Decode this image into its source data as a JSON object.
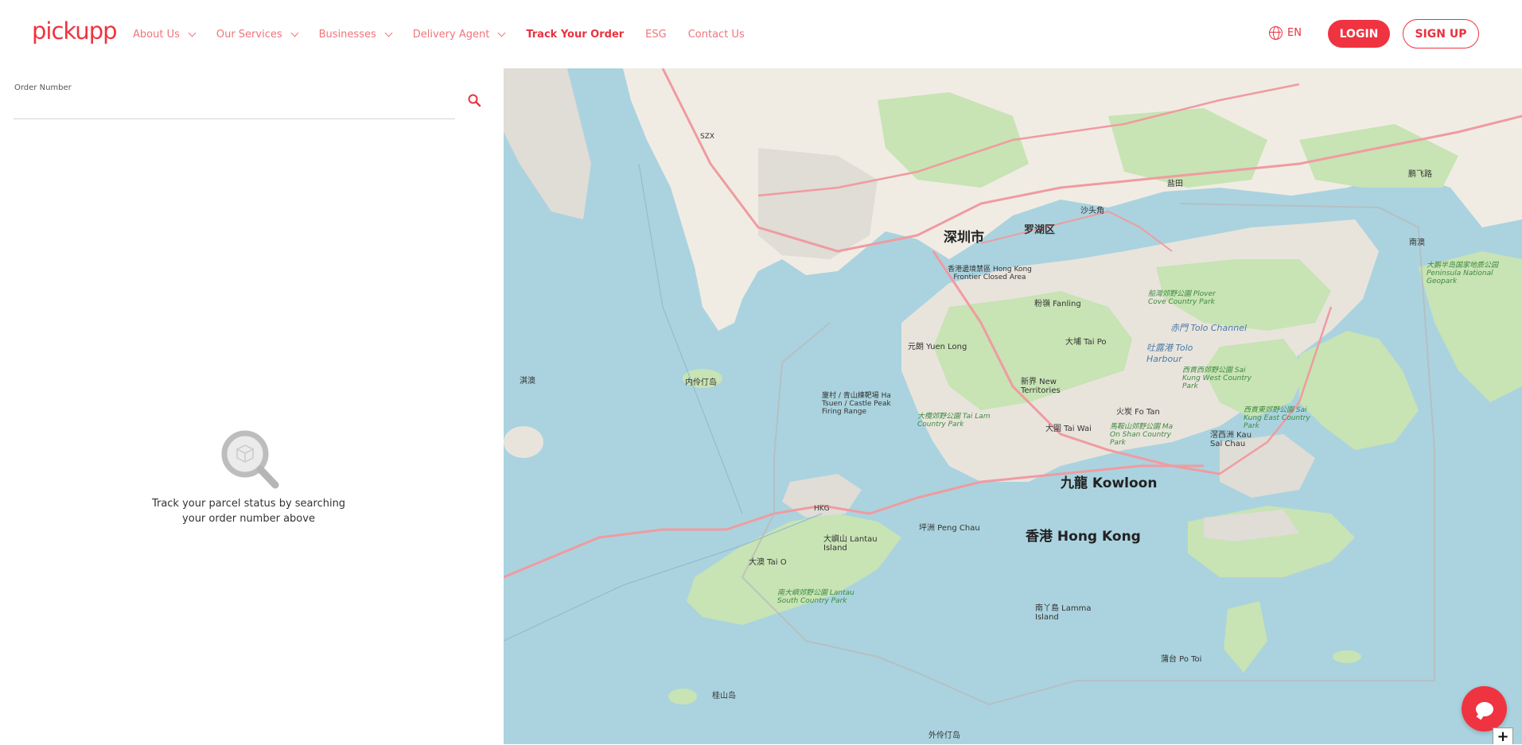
{
  "header": {
    "logo_text": "pickupp",
    "nav": [
      {
        "label": "About Us",
        "has_dropdown": true
      },
      {
        "label": "Our Services",
        "has_dropdown": true
      },
      {
        "label": "Businesses",
        "has_dropdown": true
      },
      {
        "label": "Delivery Agent",
        "has_dropdown": true
      },
      {
        "label": "Track Your Order",
        "has_dropdown": false,
        "active": true
      },
      {
        "label": "ESG",
        "has_dropdown": false
      },
      {
        "label": "Contact Us",
        "has_dropdown": false
      }
    ],
    "language": "EN",
    "login_label": "LOGIN",
    "signup_label": "SIGN UP"
  },
  "tracking": {
    "order_number_label": "Order Number",
    "order_number_value": "",
    "empty_message": "Track your parcel status by searching your order number above"
  },
  "map": {
    "labels": {
      "shenzhen": "深圳市",
      "luohu": "罗湖区",
      "kowloon": "九龍 Kowloon",
      "hongkong": "香港 Hong Kong",
      "lantau": "大嶼山 Lantau Island",
      "tai_o": "大澳 Tai O",
      "peng_chau": "坪洲 Peng Chau",
      "lamma": "南丫島 Lamma Island",
      "po_toi": "蒲台 Po Toi",
      "yuen_long": "元朗 Yuen Long",
      "tai_po": "大埔 Tai Po",
      "tai_wai": "大圍 Tai Wai",
      "fo_tan": "火炭 Fo Tan",
      "fanling": "粉嶺 Fanling",
      "new_territories": "新界 New Territories",
      "tolo_channel": "赤門 Tolo Channel",
      "tolo_harbour": "吐露港 Tolo Harbour",
      "frontier": "香港邊境禁區 Hong Kong Frontier Closed Area",
      "castle_peak": "廈村 / 青山練靶場 Ha Tsuen / Castle Peak Firing Range",
      "sai_kung": "西貢西郊野公園 Sai Kung West Country Park",
      "sai_kung_east": "西貢東郊野公園 Sai Kung East Country Park",
      "tai_lam": "大欖郊野公園 Tai Lam Country Park",
      "plover_cove": "船灣郊野公園 Plover Cove Country Park",
      "ma_on_shan": "馬鞍山郊野公園 Ma On Shan Country Park",
      "south_lantau": "南大嶼郊野公園 Lantau South Country Park",
      "sharp_island": "滘西洲 Kau Sai Chau",
      "hkg": "HKG",
      "szx": "SZX",
      "neilingding": "内伶仃岛",
      "qiao": "淇澳",
      "guishan": "桂山岛",
      "wailingding": "外伶仃岛",
      "nan_ao": "南澳",
      "peninsula": "大鹏半岛国家地质公园 Peninsula National Geopark",
      "yantian": "盐田",
      "shatoujiao": "沙头角",
      "huangsi": "鹏飞路"
    }
  }
}
